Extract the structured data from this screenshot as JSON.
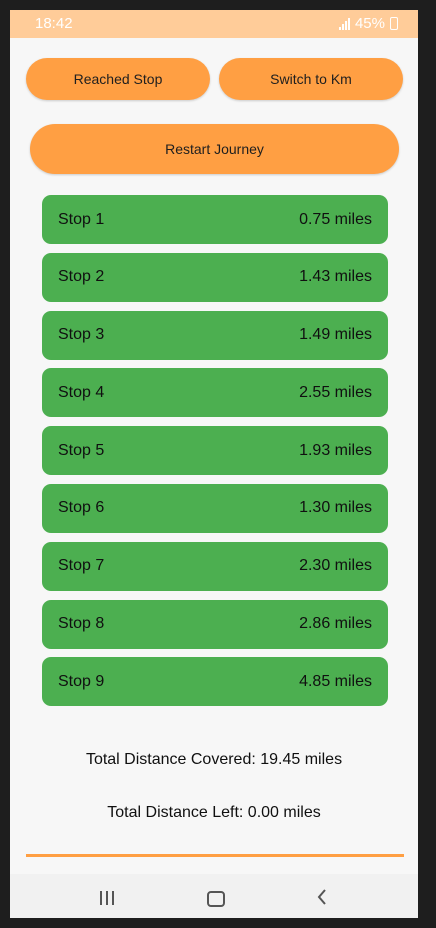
{
  "status_bar": {
    "time": "18:42",
    "battery": "45%"
  },
  "buttons": {
    "reached_stop": "Reached Stop",
    "switch_units": "Switch to Km",
    "restart": "Restart Journey"
  },
  "stops": [
    {
      "label": "Stop 1",
      "distance": "0.75 miles"
    },
    {
      "label": "Stop 2",
      "distance": "1.43 miles"
    },
    {
      "label": "Stop 3",
      "distance": "1.49 miles"
    },
    {
      "label": "Stop 4",
      "distance": "2.55 miles"
    },
    {
      "label": "Stop 5",
      "distance": "1.93 miles"
    },
    {
      "label": "Stop 6",
      "distance": "1.30 miles"
    },
    {
      "label": "Stop 7",
      "distance": "2.30 miles"
    },
    {
      "label": "Stop 8",
      "distance": "2.86 miles"
    },
    {
      "label": "Stop 9",
      "distance": "4.85 miles"
    }
  ],
  "totals": {
    "covered": "Total Distance Covered: 19.45 miles",
    "left": "Total Distance Left: 0.00 miles"
  },
  "progress": 1.0,
  "icons": {
    "signal": "signal-icon",
    "battery": "battery-icon",
    "recent_apps": "recent-apps-icon",
    "home": "home-icon",
    "back": "back-icon"
  },
  "colors": {
    "accent": "#ff9f43",
    "stop_item": "#4caf50",
    "status_bar": "#ffcc99"
  }
}
